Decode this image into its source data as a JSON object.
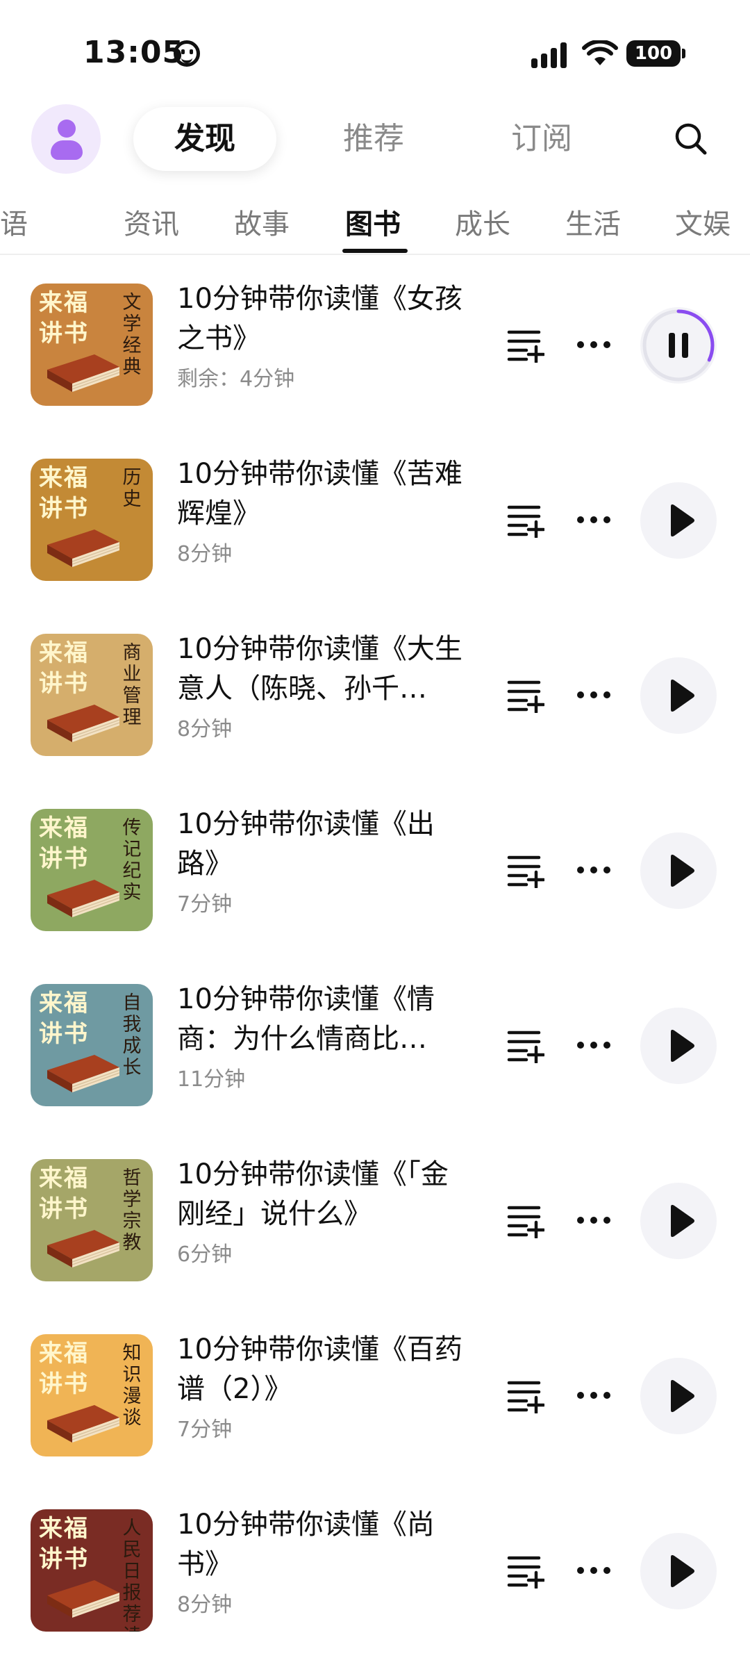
{
  "status_bar": {
    "time": "13:05",
    "battery": "100"
  },
  "top_nav": {
    "tabs": [
      {
        "label": "发现"
      },
      {
        "label": "推荐"
      },
      {
        "label": "订阅"
      }
    ]
  },
  "categories": [
    {
      "label": "英语"
    },
    {
      "label": "资讯"
    },
    {
      "label": "故事"
    },
    {
      "label": "图书"
    },
    {
      "label": "成长"
    },
    {
      "label": "生活"
    },
    {
      "label": "文娱"
    }
  ],
  "active_category": "图书",
  "cover_brand": "来福讲书",
  "books": [
    {
      "title": "10分钟带你读懂《女孩之书》",
      "duration": "剩余：4分钟",
      "cover_category": "文学经典",
      "cover_color": "#c9843e",
      "state": "playing",
      "progress": 0.32
    },
    {
      "title": "10分钟带你读懂《苦难辉煌》",
      "duration": "8分钟",
      "cover_category": "历史",
      "cover_color": "#c38a35",
      "state": "idle"
    },
    {
      "title": "10分钟带你读懂《大生意人（陈晓、孙千…",
      "duration": "8分钟",
      "cover_category": "商业管理",
      "cover_color": "#d5ae6c",
      "state": "idle"
    },
    {
      "title": "10分钟带你读懂《出路》",
      "duration": "7分钟",
      "cover_category": "传记纪实",
      "cover_color": "#8ea861",
      "state": "idle"
    },
    {
      "title": "10分钟带你读懂《情商：为什么情商比…",
      "duration": "11分钟",
      "cover_category": "自我成长",
      "cover_color": "#6f9aa2",
      "state": "idle"
    },
    {
      "title": "10分钟带你读懂《「金刚经」说什么》",
      "duration": "6分钟",
      "cover_category": "哲学宗教",
      "cover_color": "#a5a668",
      "state": "idle"
    },
    {
      "title": "10分钟带你读懂《百药谱（2）》",
      "duration": "7分钟",
      "cover_category": "知识漫谈",
      "cover_color": "#f0b455",
      "state": "idle"
    },
    {
      "title": "10分钟带你读懂《尚书》",
      "duration": "8分钟",
      "cover_category": "人民日报荐读",
      "cover_color": "#7a2c24",
      "state": "idle"
    }
  ],
  "colors": {
    "accent": "#8a4cf0",
    "text_primary": "#111111",
    "text_secondary": "#8b8b8b"
  }
}
